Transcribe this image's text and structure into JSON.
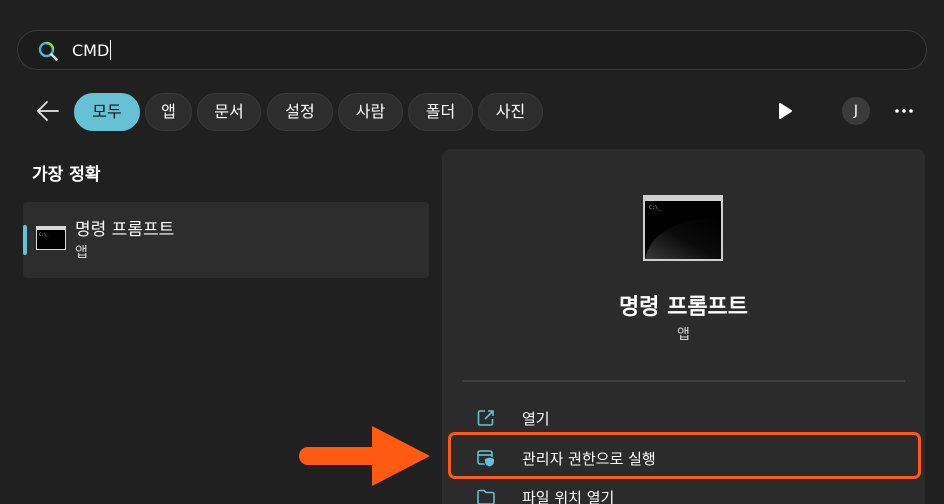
{
  "search": {
    "query": "CMD"
  },
  "filters": [
    {
      "label": "모두",
      "active": true
    },
    {
      "label": "앱",
      "active": false
    },
    {
      "label": "문서",
      "active": false
    },
    {
      "label": "설정",
      "active": false
    },
    {
      "label": "사람",
      "active": false
    },
    {
      "label": "폴더",
      "active": false
    },
    {
      "label": "사진",
      "active": false
    }
  ],
  "account": {
    "initial": "J"
  },
  "best_match": {
    "heading": "가장 정확",
    "name": "명령 프롬프트",
    "type": "앱"
  },
  "details": {
    "name": "명령 프롬프트",
    "type": "앱",
    "actions": [
      {
        "label": "열기",
        "icon": "open-external-icon"
      },
      {
        "label": "관리자 권한으로 실행",
        "icon": "admin-shield-icon"
      },
      {
        "label": "파일 위치 열기",
        "icon": "folder-icon"
      }
    ]
  },
  "colors": {
    "accent": "#67c1d5",
    "highlight": "#ff5a12",
    "background": "#202020",
    "pane": "#2b2b2b"
  }
}
